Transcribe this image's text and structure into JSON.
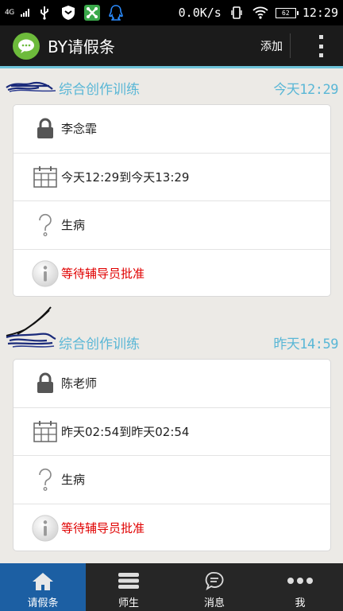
{
  "status_bar": {
    "network": "4G",
    "speed": "0.0K/s",
    "battery": "62",
    "time": "12:29"
  },
  "app_bar": {
    "title": "BY请假条",
    "add_label": "添加"
  },
  "leaves": [
    {
      "course": "综合创作训练",
      "submitted": "今天12:29",
      "approver": "李念霏",
      "period": "今天12:29到今天13:29",
      "reason": "生病",
      "status": "等待辅导员批准"
    },
    {
      "course": "综合创作训练",
      "submitted": "昨天14:59",
      "approver": "陈老师",
      "period": "昨天02:54到昨天02:54",
      "reason": "生病",
      "status": "等待辅导员批准"
    }
  ],
  "bottom_nav": [
    {
      "label": "请假条",
      "icon": "home-icon"
    },
    {
      "label": "师生",
      "icon": "list-icon"
    },
    {
      "label": "消息",
      "icon": "chat-icon"
    },
    {
      "label": "我",
      "icon": "more-dots-icon"
    }
  ],
  "colors": {
    "accent": "#5ab7d6",
    "status_text": "#e00000",
    "nav_active": "#1c5fa3",
    "app_bar": "#1b1b1b"
  }
}
